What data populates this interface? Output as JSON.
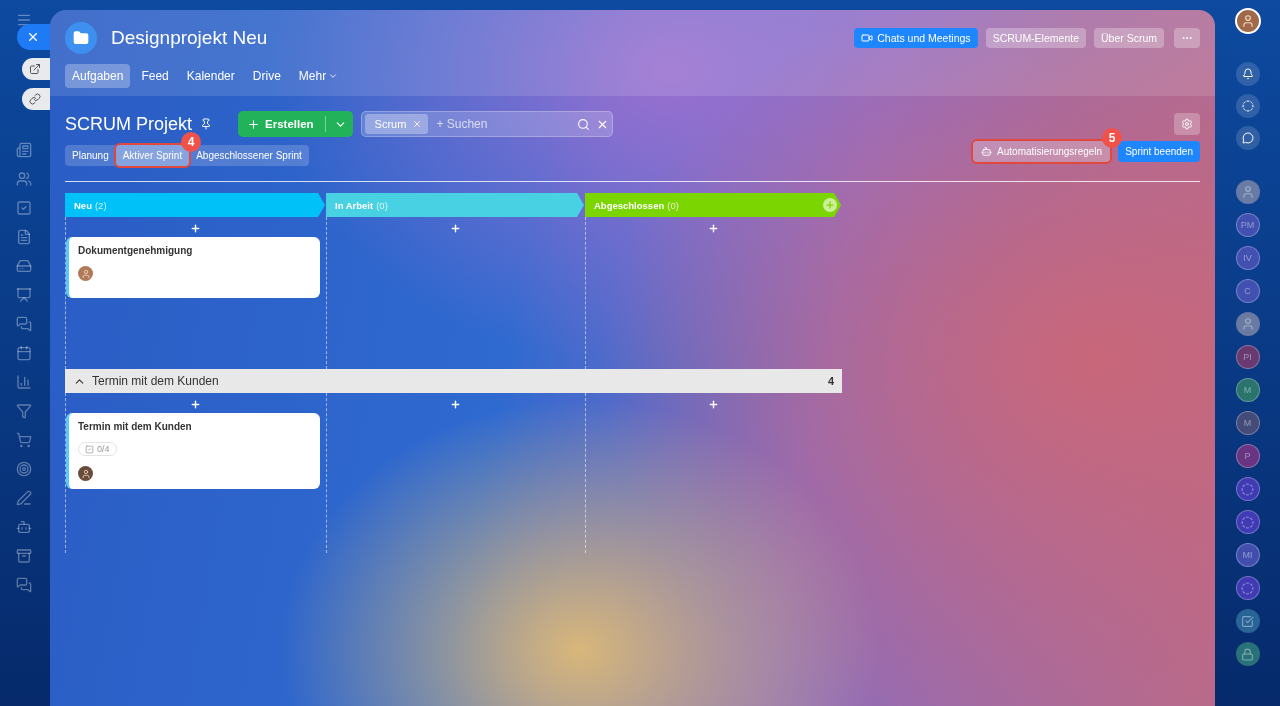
{
  "project": {
    "title": "Designprojekt Neu"
  },
  "header_buttons": [
    {
      "label": "Chats und Meetings",
      "kind": "video"
    },
    {
      "label": "SCRUM-Elemente",
      "kind": "plain"
    },
    {
      "label": "Über Scrum",
      "kind": "plain"
    }
  ],
  "nav_tabs": [
    {
      "label": "Aufgaben",
      "selected": true
    },
    {
      "label": "Feed",
      "selected": false
    },
    {
      "label": "Kalender",
      "selected": false
    },
    {
      "label": "Drive",
      "selected": false
    },
    {
      "label": "Mehr",
      "selected": false
    }
  ],
  "toolbar": {
    "title": "SCRUM Projekt",
    "create_button": "Erstellen",
    "filter_tag": "Scrum",
    "search": {
      "placeholder": "+ Suchen"
    }
  },
  "view_tabs": [
    {
      "label": "Planung",
      "selected": false
    },
    {
      "label": "Aktiver Sprint",
      "selected": true,
      "callout": "4"
    },
    {
      "label": "Abgeschlossener Sprint",
      "selected": false
    }
  ],
  "actions": {
    "automation": {
      "label": "Automatisierungsregeln",
      "callout": "5"
    },
    "finish": "Sprint beenden"
  },
  "columns": [
    {
      "name": "Neu",
      "count": "(2)",
      "color": "#00c2f8"
    },
    {
      "name": "In Arbeit",
      "count": "(0)",
      "color": "#47d1e2"
    },
    {
      "name": "Abgeschlossen",
      "count": "(0)",
      "color": "#7bd500"
    }
  ],
  "lanes": [
    {
      "cards": [
        {
          "title": "Dokumentgenehmigung"
        }
      ]
    },
    {
      "title": "Termin mit dem Kunden",
      "count": "4",
      "expanded": true,
      "cards": [
        {
          "title": "Termin mit dem Kunden",
          "checklist": "0/4"
        }
      ]
    }
  ],
  "contacts": [
    {
      "kind": "photo"
    },
    {
      "kind": "initials",
      "initials": "PM",
      "color": "#4c54b8"
    },
    {
      "kind": "initials",
      "initials": "IV",
      "color": "#4c54b8"
    },
    {
      "kind": "initials",
      "initials": "C",
      "color": "#4c54b8"
    },
    {
      "kind": "photo"
    },
    {
      "kind": "initials",
      "initials": "PI",
      "color": "#7a3a6e"
    },
    {
      "kind": "initials",
      "initials": "M",
      "color": "#2f7f6a"
    },
    {
      "kind": "initials",
      "initials": "M",
      "color": "#4f4f78"
    },
    {
      "kind": "initials",
      "initials": "P",
      "color": "#7a3585"
    },
    {
      "kind": "bot"
    },
    {
      "kind": "bot"
    },
    {
      "kind": "initials",
      "initials": "MI",
      "color": "#4c54b8"
    },
    {
      "kind": "bot"
    },
    {
      "kind": "task"
    },
    {
      "kind": "lock"
    }
  ]
}
